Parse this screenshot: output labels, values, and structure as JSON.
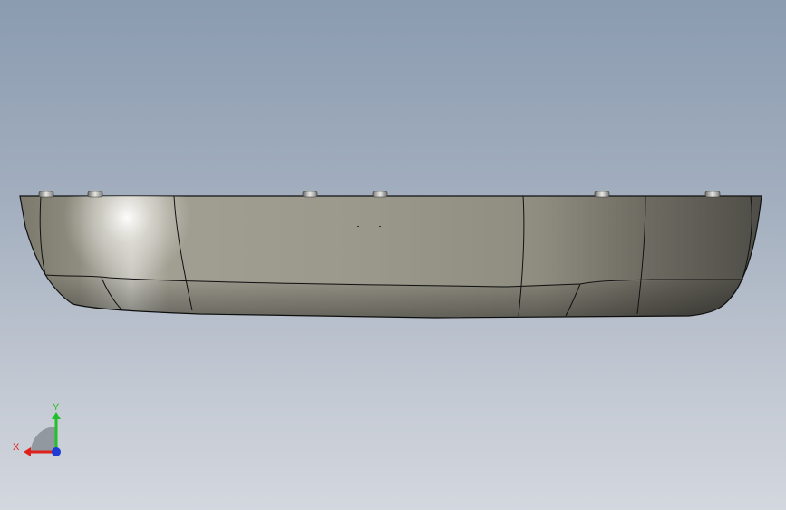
{
  "viewport": {
    "background_top": "#8b9bb0",
    "background_bottom": "#d3d7de"
  },
  "model": {
    "surface_color": "#8f8c80",
    "edge_color": "#111111"
  },
  "triad": {
    "x_label": "X",
    "y_label": "Y",
    "x_color": "#e0201c",
    "y_color": "#22c02a",
    "z_color": "#1f3bd6"
  }
}
